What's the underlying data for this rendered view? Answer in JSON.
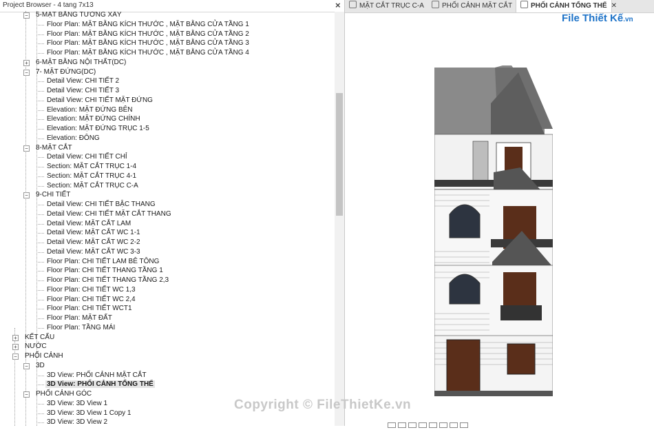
{
  "browser": {
    "title": "Project Browser - 4 tang 7x13",
    "tree": [
      {
        "label": "5-MẶT BẰNG TƯỜNG XÂY",
        "level": 2,
        "toggle": "−"
      },
      {
        "label": "Floor Plan: MẶT BẰNG KÍCH THƯỚC , MẶT BẰNG CỬA TẦNG 1",
        "level": 3
      },
      {
        "label": "Floor Plan: MẶT BẰNG KÍCH THƯỚC , MẶT BẰNG CỬA TẦNG 2",
        "level": 3
      },
      {
        "label": "Floor Plan: MẶT BẰNG KÍCH THƯỚC , MẶT BẰNG CỬA TẦNG 3",
        "level": 3
      },
      {
        "label": "Floor Plan: MẶT BẰNG KÍCH THƯỚC , MẶT BẰNG CỬA TẦNG 4",
        "level": 3
      },
      {
        "label": "6-MẶT BẰNG NỘI THẤT(DC)",
        "level": 2,
        "toggle": "+"
      },
      {
        "label": "7- MẶT ĐỨNG(DC)",
        "level": 2,
        "toggle": "−"
      },
      {
        "label": "Detail View: CHI TIẾT 2",
        "level": 3
      },
      {
        "label": "Detail View: CHI TIẾT 3",
        "level": 3
      },
      {
        "label": "Detail View: CHI TIẾT MẶT ĐỨNG",
        "level": 3
      },
      {
        "label": "Elevation: MẶT ĐỨNG BÊN",
        "level": 3
      },
      {
        "label": "Elevation: MẶT ĐỨNG CHÍNH",
        "level": 3
      },
      {
        "label": "Elevation: MẶT ĐỨNG TRỤC 1-5",
        "level": 3
      },
      {
        "label": "Elevation: ĐÔNG",
        "level": 3
      },
      {
        "label": "8-MẶT CẮT",
        "level": 2,
        "toggle": "−"
      },
      {
        "label": "Detail View: CHI TIẾT CHỈ",
        "level": 3
      },
      {
        "label": "Section: MẶT CẮT TRỤC 1-4",
        "level": 3
      },
      {
        "label": "Section: MẶT CẮT TRỤC 4-1",
        "level": 3
      },
      {
        "label": "Section: MẶT CẮT TRỤC C-A",
        "level": 3
      },
      {
        "label": "9-CHI TIẾT",
        "level": 2,
        "toggle": "−"
      },
      {
        "label": "Detail View: CHI TIẾT BẬC THANG",
        "level": 3
      },
      {
        "label": "Detail View: CHI TIẾT MẶT CẮT THANG",
        "level": 3
      },
      {
        "label": "Detail View: MẶT CẮT LAM",
        "level": 3
      },
      {
        "label": "Detail View: MẶT CẮT WC 1-1",
        "level": 3
      },
      {
        "label": "Detail View: MẶT CẮT WC 2-2",
        "level": 3
      },
      {
        "label": "Detail View: MẶT CẮT WC 3-3",
        "level": 3
      },
      {
        "label": "Floor Plan: CHI TIẾT LAM BÊ TÔNG",
        "level": 3
      },
      {
        "label": "Floor Plan: CHI TIẾT THANG TẦNG 1",
        "level": 3
      },
      {
        "label": "Floor Plan: CHI TIẾT THANG TẦNG 2,3",
        "level": 3
      },
      {
        "label": "Floor Plan: CHI TIẾT WC 1,3",
        "level": 3
      },
      {
        "label": "Floor Plan: CHI TIẾT WC 2,4",
        "level": 3
      },
      {
        "label": "Floor Plan: CHI TIẾT WCT1",
        "level": 3
      },
      {
        "label": "Floor Plan: MẶT ĐẤT",
        "level": 3
      },
      {
        "label": "Floor Plan: TẦNG MÁI",
        "level": 3
      },
      {
        "label": "KẾT CẤU",
        "level": 1,
        "toggle": "+"
      },
      {
        "label": "NƯỚC",
        "level": 1,
        "toggle": "+"
      },
      {
        "label": "PHỐI CẢNH",
        "level": 1,
        "toggle": "−"
      },
      {
        "label": "3D",
        "level": 2,
        "toggle": "−"
      },
      {
        "label": "3D View: PHỐI CẢNH MẶT CẮT",
        "level": 3
      },
      {
        "label": "3D View: PHỐI CẢNH TỔNG THỂ",
        "level": 3,
        "selected": true
      },
      {
        "label": "PHỐI CẢNH GÓC",
        "level": 2,
        "toggle": "−"
      },
      {
        "label": "3D View: 3D View 1",
        "level": 3
      },
      {
        "label": "3D View: 3D View 1 Copy 1",
        "level": 3
      },
      {
        "label": "3D View: 3D View 2",
        "level": 3
      }
    ]
  },
  "tabs": [
    {
      "label": "MẶT CẮT TRỤC C-A",
      "icon": "section-icon",
      "active": false
    },
    {
      "label": "PHỐI CẢNH MẶT CẮT",
      "icon": "3d-view-icon",
      "active": false
    },
    {
      "label": "PHỐI CẢNH TỔNG THỂ",
      "icon": "3d-view-icon",
      "active": true
    }
  ],
  "logo": {
    "brand": "File Thiết Kế",
    "suffix": ".vn"
  },
  "watermark": "Copyright © FileThietKe.vn",
  "colors": {
    "accent": "#1e73c8",
    "selected_bg": "#e5e5e5",
    "roof": "#7a7a7a",
    "door": "#5a2e1a"
  }
}
